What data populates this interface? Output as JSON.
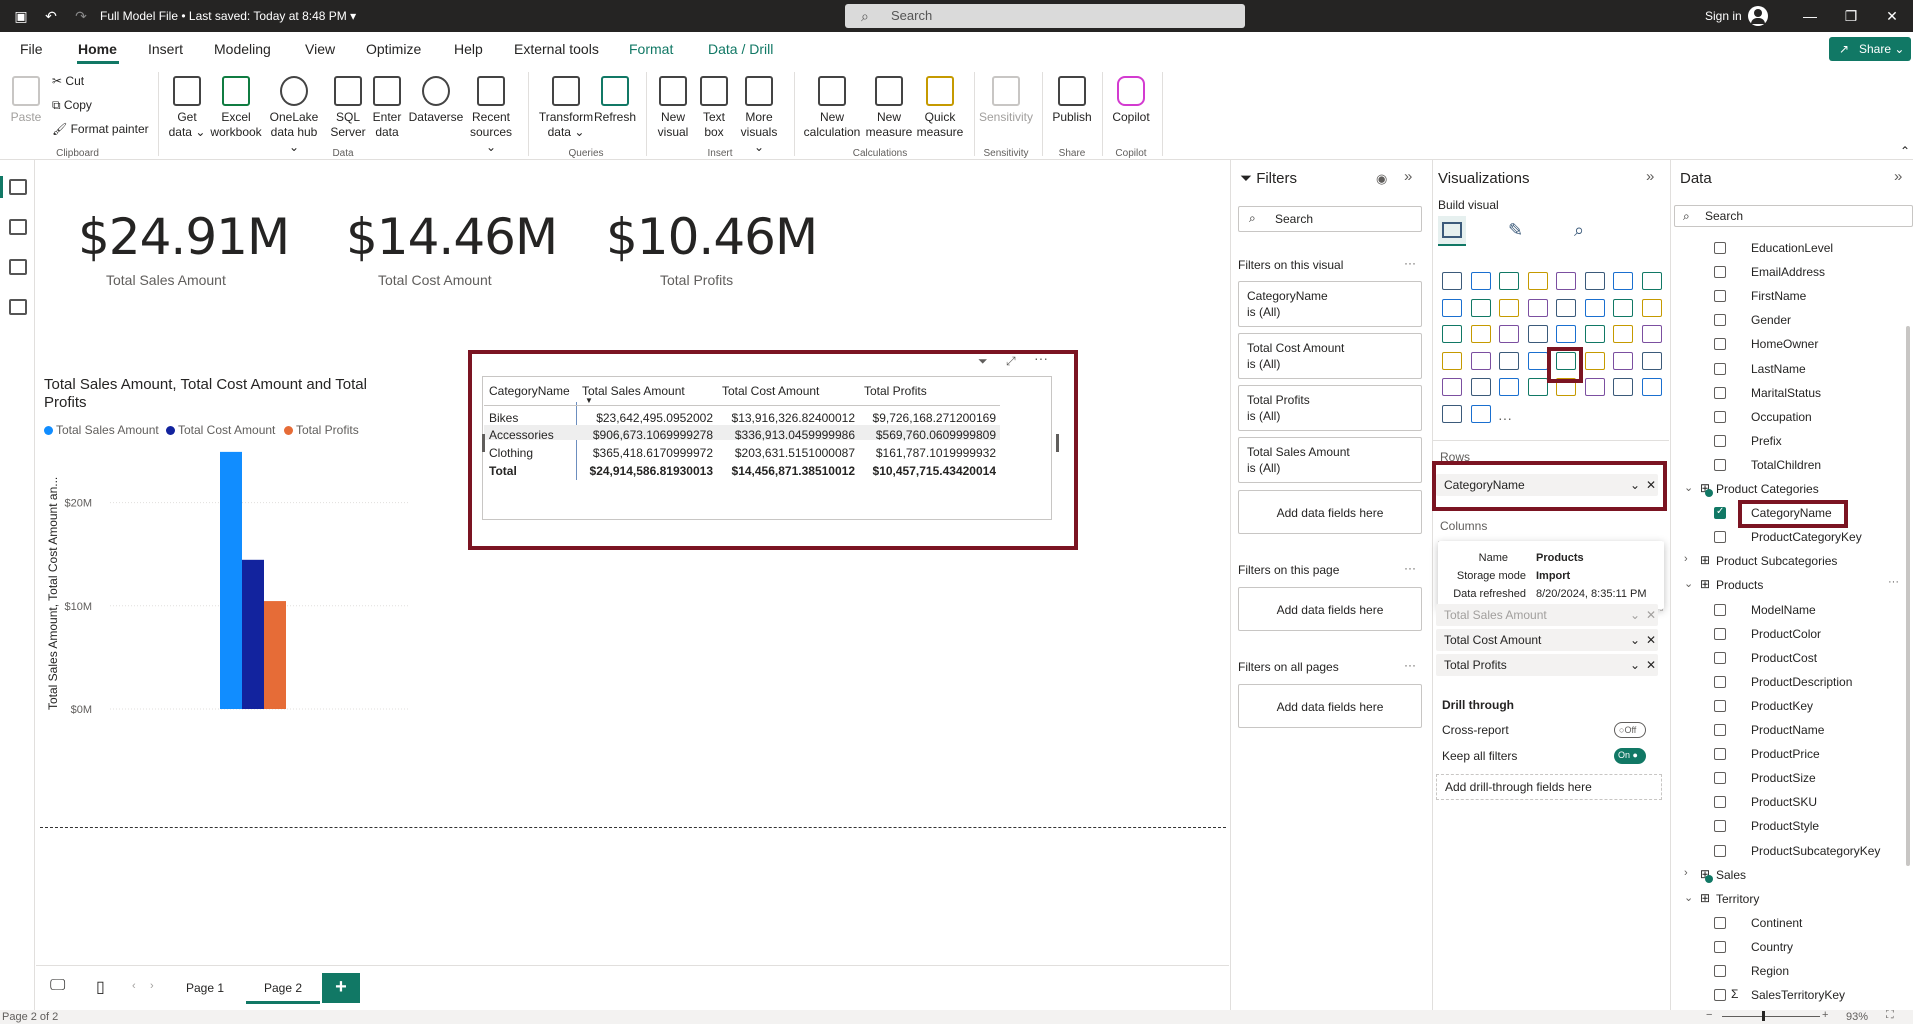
{
  "title": "Full Model File • Last saved: Today at 8:48 PM",
  "search_placeholder": "Search",
  "signin": "Sign in",
  "share": "Share",
  "menu": [
    "File",
    "Home",
    "Insert",
    "Modeling",
    "View",
    "Optimize",
    "Help",
    "External tools",
    "Format",
    "Data / Drill"
  ],
  "ribbon": {
    "clipboard": {
      "paste": "Paste",
      "cut": "Cut",
      "copy": "Copy",
      "format_painter": "Format painter",
      "group": "Clipboard"
    },
    "data": {
      "get_data": "Get data ⌄",
      "excel": "Excel workbook",
      "onelake": "OneLake data hub ⌄",
      "sql": "SQL Server",
      "enter": "Enter data",
      "dataverse": "Dataverse",
      "recent": "Recent sources ⌄",
      "group": "Data"
    },
    "queries": {
      "transform": "Transform data ⌄",
      "refresh": "Refresh",
      "group": "Queries"
    },
    "insert": {
      "new_visual": "New visual",
      "text_box": "Text box",
      "more_visuals": "More visuals ⌄",
      "group": "Insert"
    },
    "calculations": {
      "new_calc": "New calculation",
      "new_measure": "New measure",
      "quick_measure": "Quick measure",
      "group": "Calculations"
    },
    "sensitivity": {
      "label": "Sensitivity",
      "group": "Sensitivity"
    },
    "share": {
      "publish": "Publish",
      "group": "Share"
    },
    "copilot": {
      "label": "Copilot",
      "group": "Copilot"
    }
  },
  "cards": [
    {
      "value": "$24.91M",
      "label": "Total Sales Amount"
    },
    {
      "value": "$14.46M",
      "label": "Total Cost Amount"
    },
    {
      "value": "$10.46M",
      "label": "Total Profits"
    }
  ],
  "chart_data": {
    "type": "bar",
    "title": "Total Sales Amount, Total Cost Amount and Total Profits",
    "ylabel": "Total Sales Amount, Total Cost Amount an...",
    "ylim": [
      0,
      25000000
    ],
    "yticks": [
      "$0M",
      "$10M",
      "$20M"
    ],
    "series": [
      {
        "name": "Total Sales Amount",
        "value": 24914586.8193,
        "color": "#118DFF"
      },
      {
        "name": "Total Cost Amount",
        "value": 14456871.3851,
        "color": "#12239E"
      },
      {
        "name": "Total Profits",
        "value": 10457715.4342,
        "color": "#E66C37"
      }
    ],
    "legend": "top-left"
  },
  "matrix": {
    "headers": [
      "CategoryName",
      "Total Sales Amount",
      "Total Cost Amount",
      "Total Profits"
    ],
    "rows": [
      [
        "Bikes",
        "$23,642,495.0952002",
        "$13,916,326.82400012",
        "$9,726,168.271200169"
      ],
      [
        "Accessories",
        "$906,673.1069999278",
        "$336,913.0459999986",
        "$569,760.0609999809"
      ],
      [
        "Clothing",
        "$365,418.6170999972",
        "$203,631.5151000087",
        "$161,787.1019999932"
      ],
      [
        "Total",
        "$24,914,586.81930013",
        "$14,456,871.38510012",
        "$10,457,715.43420014"
      ]
    ]
  },
  "pages": [
    "Page 1",
    "Page 2"
  ],
  "status": "Page 2 of 2",
  "zoom": "93%",
  "filters": {
    "title": "Filters",
    "search": "Search",
    "on_visual": "Filters on this visual",
    "items": [
      {
        "name": "CategoryName",
        "state": "is (All)"
      },
      {
        "name": "Total Cost Amount",
        "state": "is (All)"
      },
      {
        "name": "Total Profits",
        "state": "is (All)"
      },
      {
        "name": "Total Sales Amount",
        "state": "is (All)"
      }
    ],
    "add": "Add data fields here",
    "on_page": "Filters on this page",
    "on_all": "Filters on all pages"
  },
  "viz": {
    "title": "Visualizations",
    "build": "Build visual",
    "rows": "Rows",
    "rows_field": "CategoryName",
    "columns": "Columns",
    "tooltip": {
      "name_label": "Name",
      "name": "Products",
      "storage_label": "Storage mode",
      "storage": "Import",
      "refreshed_label": "Data refreshed",
      "refreshed": "8/20/2024, 8:35:11 PM"
    },
    "values": [
      "Total Sales Amount",
      "Total Cost Amount",
      "Total Profits"
    ],
    "drill": "Drill through",
    "cross": "Cross-report",
    "cross_state": "Off",
    "keep": "Keep all filters",
    "keep_state": "On",
    "add_drill": "Add drill-through fields here"
  },
  "data": {
    "title": "Data",
    "search": "Search",
    "customer_fields": [
      "EducationLevel",
      "EmailAddress",
      "FirstName",
      "Gender",
      "HomeOwner",
      "LastName",
      "MaritalStatus",
      "Occupation",
      "Prefix",
      "TotalChildren"
    ],
    "tables": [
      "Product Categories",
      "Product Subcategories",
      "Products",
      "Sales",
      "Territory"
    ],
    "category_fields": [
      "CategoryName",
      "ProductCategoryKey"
    ],
    "product_fields": [
      "ModelName",
      "ProductColor",
      "ProductCost",
      "ProductDescription",
      "ProductKey",
      "ProductName",
      "ProductPrice",
      "ProductSize",
      "ProductSKU",
      "ProductStyle",
      "ProductSubcategoryKey"
    ],
    "territory_fields": [
      "Continent",
      "Country",
      "Region",
      "SalesTerritoryKey"
    ]
  }
}
